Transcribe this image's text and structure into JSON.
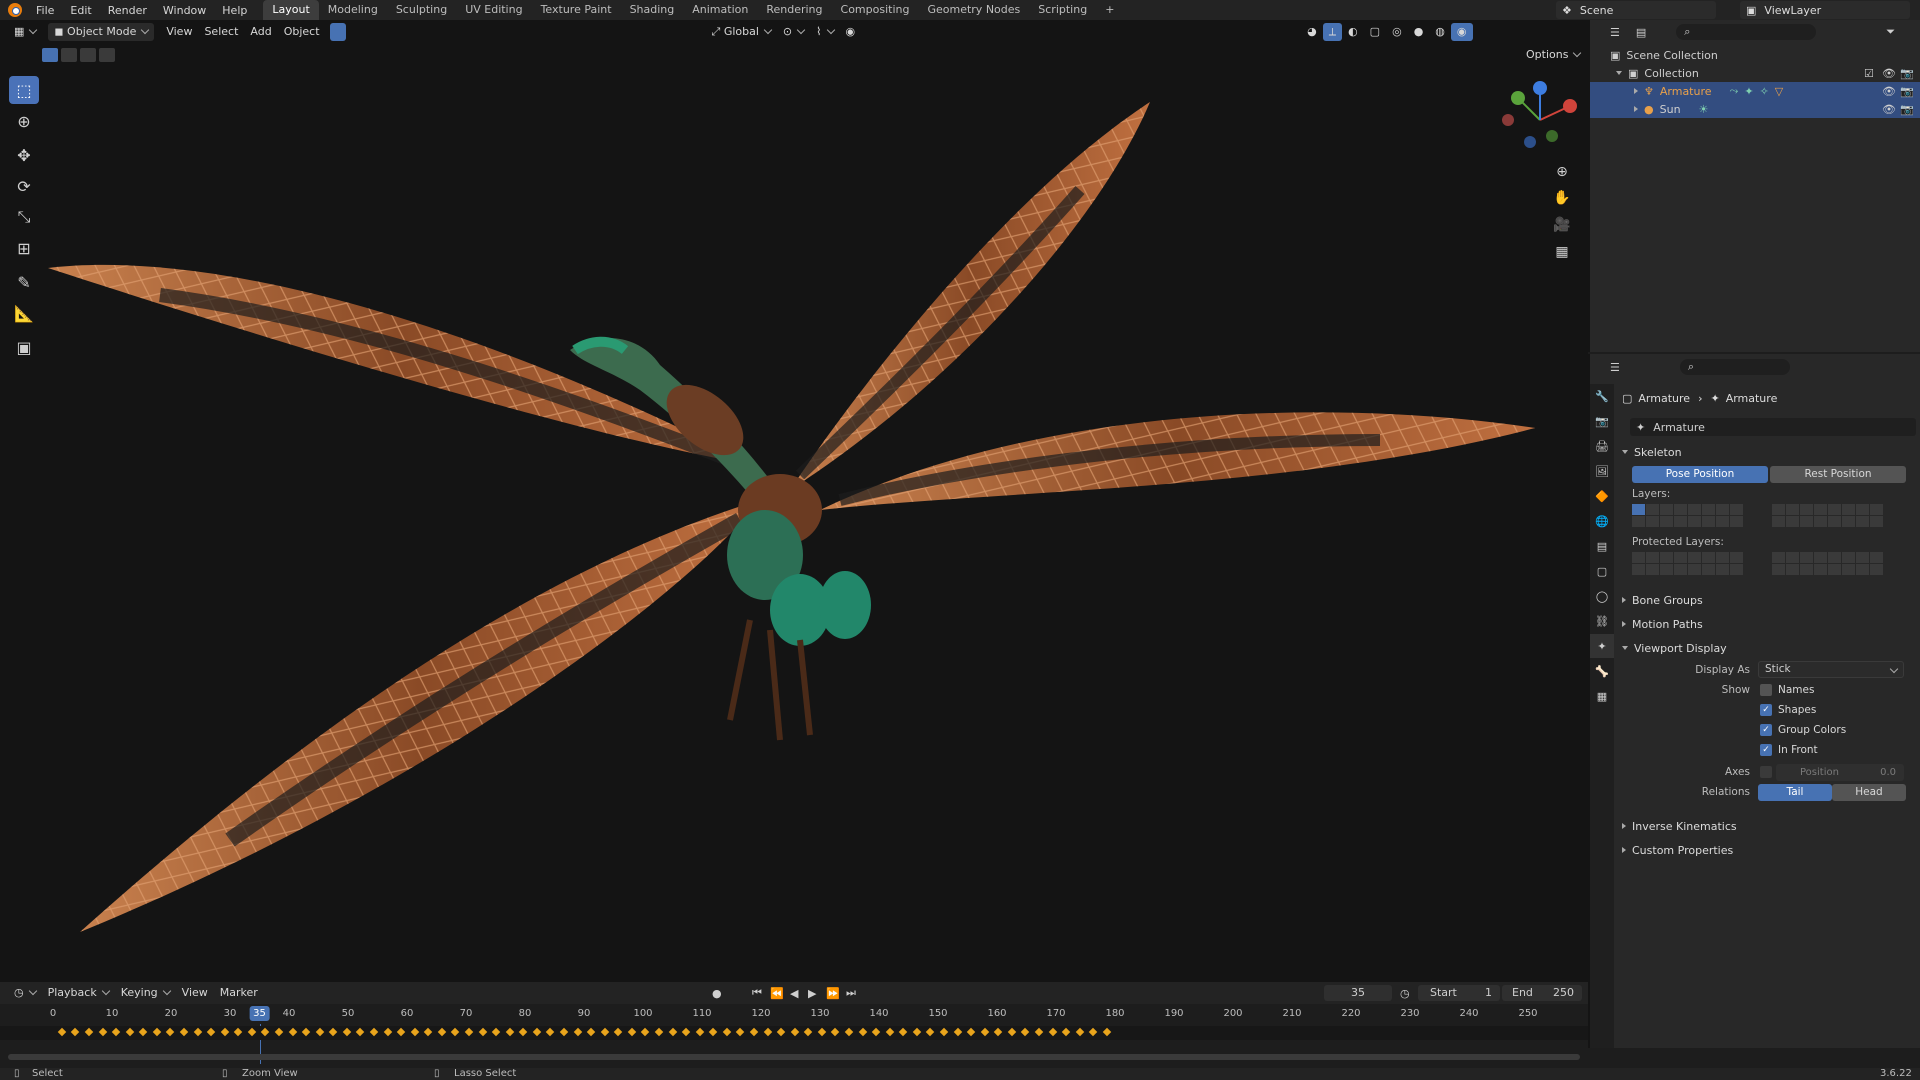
{
  "topbar": {
    "menus": [
      "File",
      "Edit",
      "Render",
      "Window",
      "Help"
    ],
    "workspaces": [
      "Layout",
      "Modeling",
      "Sculpting",
      "UV Editing",
      "Texture Paint",
      "Shading",
      "Animation",
      "Rendering",
      "Compositing",
      "Geometry Nodes",
      "Scripting"
    ],
    "active_workspace": "Layout",
    "add_tab": "+",
    "scene_name": "Scene",
    "view_layer": "ViewLayer"
  },
  "viewport_header": {
    "mode": "Object Mode",
    "menus": [
      "View",
      "Select",
      "Add",
      "Object"
    ],
    "orientation": "Global",
    "options": "Options"
  },
  "toolbar": {
    "tools": [
      "select-box",
      "cursor",
      "move",
      "rotate",
      "scale",
      "transform",
      "annotate",
      "measure",
      "add-cube"
    ],
    "active_tool": "select-box"
  },
  "outliner": {
    "root": "Scene Collection",
    "collection": "Collection",
    "items": [
      {
        "name": "Armature",
        "type": "armature",
        "selected": true
      },
      {
        "name": "Sun",
        "type": "light",
        "selected": true
      }
    ]
  },
  "properties": {
    "breadcrumb": [
      "Armature",
      "Armature"
    ],
    "data_name": "Armature",
    "skeleton": {
      "title": "Skeleton",
      "pose_position": "Pose Position",
      "rest_position": "Rest Position",
      "active_position": "Pose Position",
      "layers_label": "Layers:",
      "protected_layers_label": "Protected Layers:"
    },
    "collapsed_panels": [
      "Bone Groups",
      "Motion Paths"
    ],
    "viewport_display": {
      "title": "Viewport Display",
      "display_as_label": "Display As",
      "display_as_value": "Stick",
      "show_label": "Show",
      "names": {
        "label": "Names",
        "checked": false
      },
      "shapes": {
        "label": "Shapes",
        "checked": true
      },
      "group_colors": {
        "label": "Group Colors",
        "checked": true
      },
      "in_front": {
        "label": "In Front",
        "checked": true
      },
      "axes_label": "Axes",
      "axes_position_label": "Position",
      "axes_position_value": "0.0",
      "relations_label": "Relations",
      "relations_tail": "Tail",
      "relations_head": "Head",
      "relations_active": "Tail"
    },
    "bottom_panels": [
      "Inverse Kinematics",
      "Custom Properties"
    ]
  },
  "timeline": {
    "menus": [
      "Playback",
      "Keying",
      "View",
      "Marker"
    ],
    "current_frame": "35",
    "start_label": "Start",
    "start_value": "1",
    "end_label": "End",
    "end_value": "250",
    "ruler_labels": [
      "0",
      "10",
      "20",
      "30",
      "40",
      "50",
      "60",
      "70",
      "80",
      "90",
      "100",
      "110",
      "120",
      "130",
      "140",
      "150",
      "160",
      "170",
      "180",
      "190",
      "200",
      "210",
      "220",
      "230",
      "240",
      "250"
    ],
    "cursor_label": "35"
  },
  "status_bar": {
    "select": "Select",
    "zoom_view": "Zoom View",
    "lasso_select": "Lasso Select",
    "version": "3.6.22"
  },
  "colors": {
    "accent": "#4772b3",
    "wing": "#b5673a",
    "body": "#2f7a55",
    "keyframe": "#e8a41c"
  }
}
